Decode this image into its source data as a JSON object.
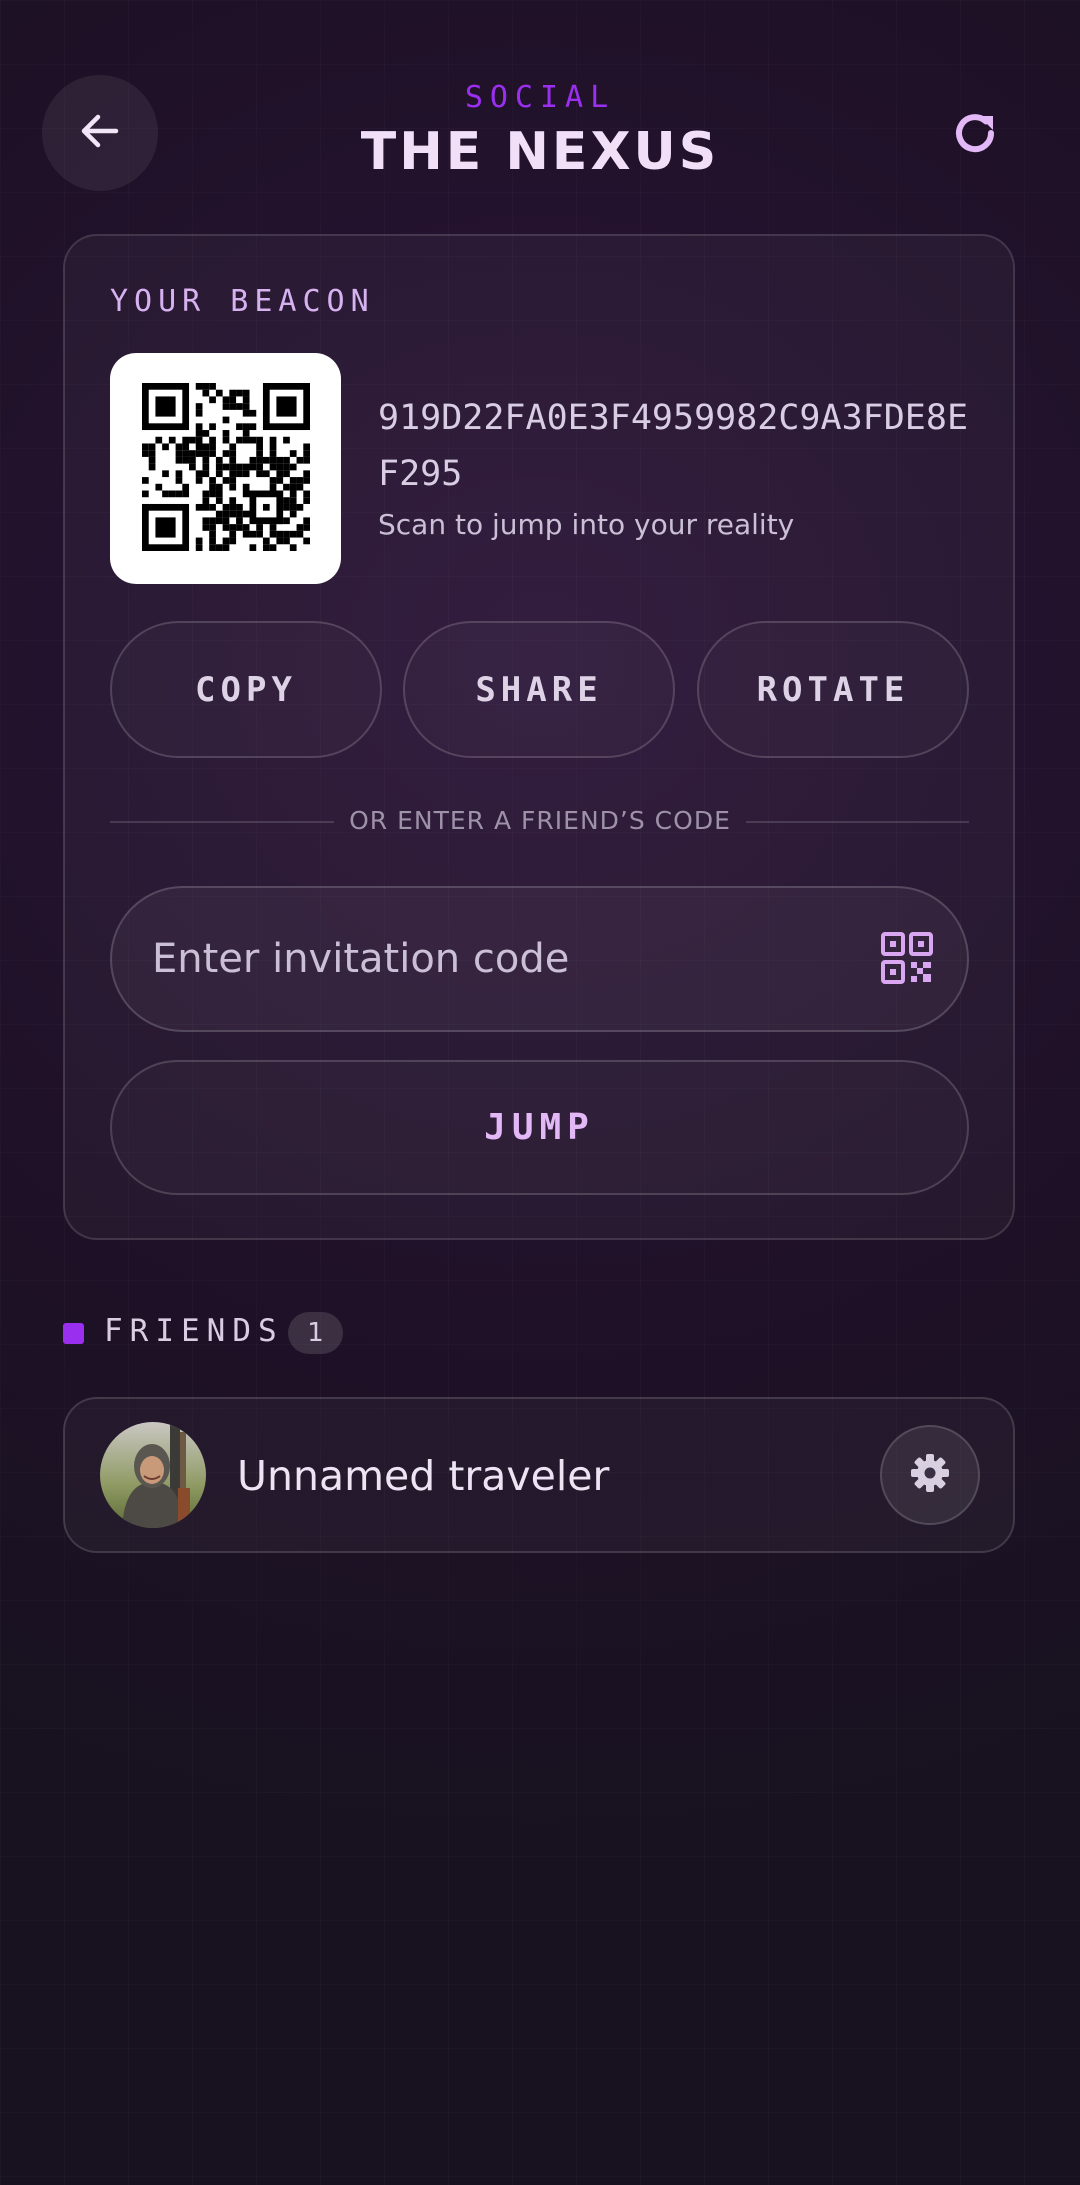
{
  "header": {
    "subtitle": "SOCIAL",
    "title": "THE NEXUS",
    "back_icon": "arrow-left-icon",
    "refresh_icon": "refresh-icon"
  },
  "beacon": {
    "label": "YOUR BEACON",
    "code": "919D22FA0E3F4959982C9A3FDE8EF295",
    "hint": "Scan to jump into your reality",
    "qr_icon": "qr-code-icon",
    "actions": {
      "copy": "COPY",
      "share": "SHARE",
      "rotate": "ROTATE"
    },
    "divider": "OR ENTER A FRIEND’S CODE",
    "input": {
      "value": "",
      "placeholder": "Enter invitation code"
    },
    "scan_icon": "qr-scan-icon",
    "jump_label": "JUMP"
  },
  "friends": {
    "label": "FRIENDS",
    "count": "1",
    "items": [
      {
        "name": "Unnamed traveler",
        "avatar_icon": "avatar-photo",
        "settings_icon": "gear-icon"
      }
    ]
  },
  "colors": {
    "background": "#181220",
    "accent": "#9b2ff0",
    "title": "#f1dff8",
    "icon_tint": "#e3b8f7"
  }
}
